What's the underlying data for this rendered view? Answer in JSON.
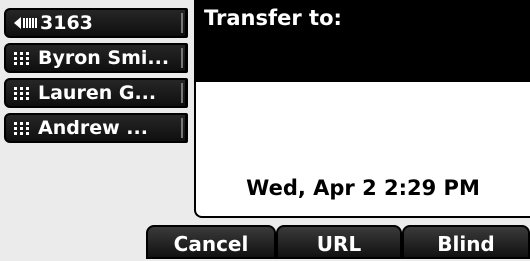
{
  "line_keys": [
    {
      "icon": "speaker-icon",
      "label": "3163"
    },
    {
      "icon": "contact-icon",
      "label": "Byron Smi..."
    },
    {
      "icon": "contact-icon",
      "label": "Lauren G..."
    },
    {
      "icon": "contact-icon",
      "label": "Andrew ..."
    }
  ],
  "panel": {
    "header": "Transfer to:",
    "datetime": "Wed, Apr 2  2:29 PM"
  },
  "softkeys": {
    "cancel": "Cancel",
    "url": "URL",
    "blind": "Blind"
  }
}
